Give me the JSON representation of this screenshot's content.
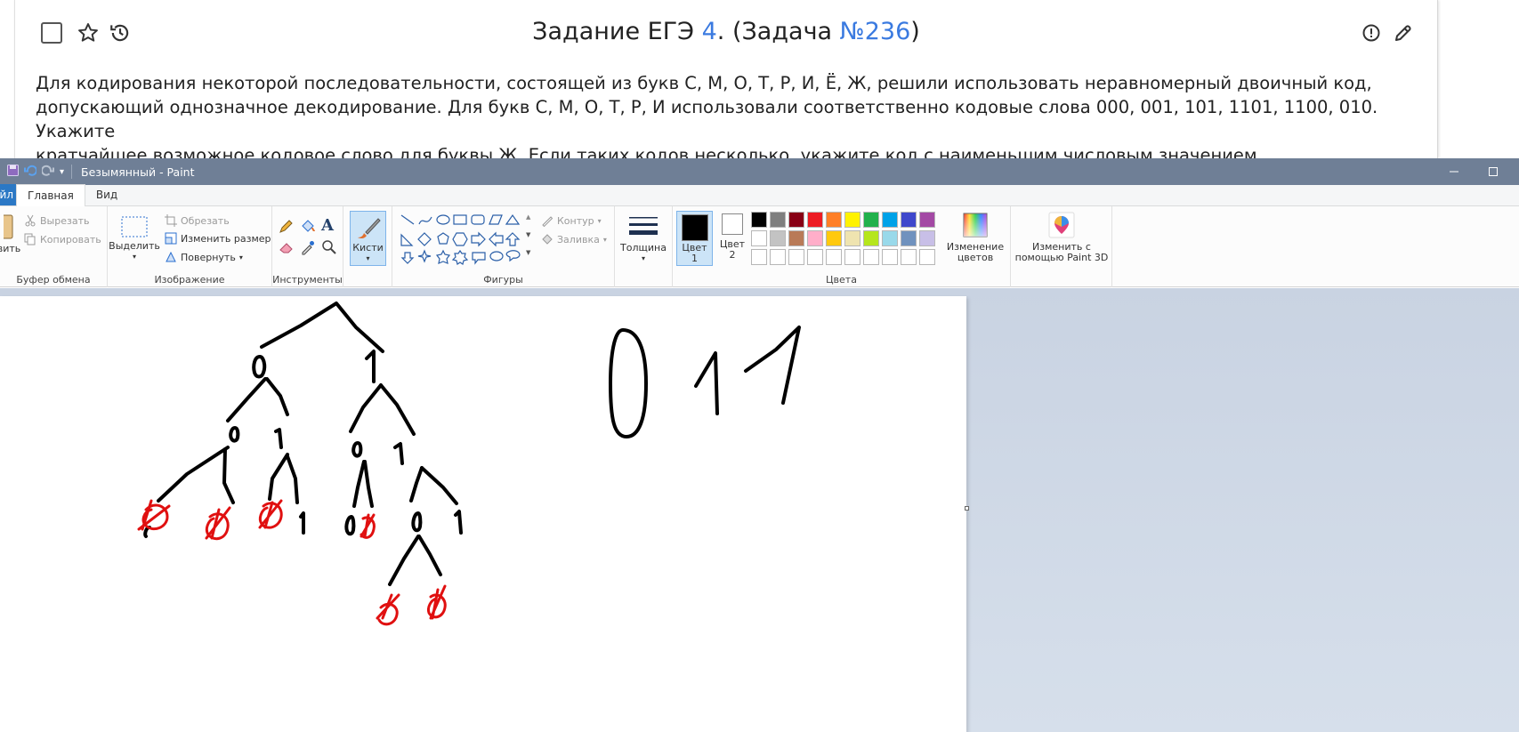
{
  "task": {
    "title_prefix": "Задание ЕГЭ ",
    "title_num": "4",
    "title_mid": ". (Задача ",
    "title_task_no": "№236",
    "title_suffix": ")",
    "text_line1": "Для кодирования некоторой последовательности, состоящей из букв С, М, О, Т, Р, И, Ё, Ж, решили использовать неравномерный двоичный код,",
    "text_line2": "допускающий однозначное декодирование. Для букв С, М, О, Т, Р, И использовали соответственно кодовые слова 000, 001, 101, 1101, 1100, 010. Укажите",
    "text_line3": "кратчайшее возможное кодовое слово для буквы Ж. Если таких кодов несколько, укажите код с наименьшим числовым значением."
  },
  "paint": {
    "window_title": "Безымянный - Paint",
    "tabs": {
      "file": "йл",
      "home": "Главная",
      "view": "Вид"
    },
    "clipboard": {
      "paste": "вить",
      "cut": "Вырезать",
      "copy": "Копировать",
      "label": "Буфер обмена"
    },
    "image": {
      "select": "Выделить",
      "crop": "Обрезать",
      "resize": "Изменить размер",
      "rotate": "Повернуть",
      "label": "Изображение"
    },
    "tools": {
      "label": "Инструменты"
    },
    "brushes": {
      "label": "Кисти"
    },
    "shapes": {
      "outline": "Контур",
      "fill": "Заливка",
      "label": "Фигуры"
    },
    "size": {
      "label": "Толщина"
    },
    "colors": {
      "color1": "Цвет",
      "color1_num": "1",
      "color2": "Цвет",
      "color2_num": "2",
      "edit_line1": "Изменение",
      "edit_line2": "цветов",
      "label": "Цвета",
      "palette_row1": [
        "#000000",
        "#7f7f7f",
        "#880015",
        "#ed1c24",
        "#ff7f27",
        "#fff200",
        "#22b14c",
        "#00a2e8",
        "#3f48cc",
        "#a349a4"
      ],
      "palette_row2": [
        "#ffffff",
        "#c3c3c3",
        "#b97a57",
        "#ffaec9",
        "#ffc90e",
        "#efe4b0",
        "#b5e61d",
        "#99d9ea",
        "#7092be",
        "#c8bfe7"
      ],
      "palette_row3": [
        "#ffffff",
        "#ffffff",
        "#ffffff",
        "#ffffff",
        "#ffffff",
        "#ffffff",
        "#ffffff",
        "#ffffff",
        "#ffffff",
        "#ffffff"
      ],
      "current_color1": "#000000",
      "current_color2": "#ffffff"
    },
    "paint3d": {
      "line1": "Изменить с",
      "line2": "помощью Paint 3D"
    }
  },
  "drawing": {
    "answer": "011",
    "node_digits": [
      "0",
      "1",
      "0",
      "1",
      "0",
      "1",
      "1",
      "0",
      "1",
      "0",
      "1"
    ]
  }
}
